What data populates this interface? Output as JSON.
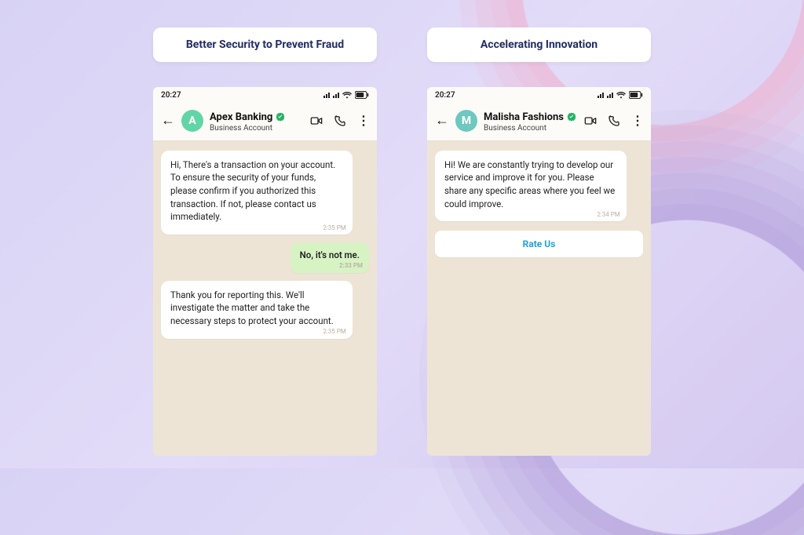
{
  "left": {
    "label": "Better Security to Prevent Fraud",
    "status_time": "20:27",
    "avatar_letter": "A",
    "avatar_color": "#62d5a6",
    "business_name": "Apex Banking",
    "business_sub": "Business Account",
    "messages": [
      {
        "kind": "incoming",
        "text": "Hi, There's a transaction on your account. To ensure the security of your funds, please confirm if you authorized this transaction. If not, please contact us immediately.",
        "time": "2:35 PM"
      },
      {
        "kind": "outgoing",
        "text": "No, it's not me.",
        "time": "2:33 PM"
      },
      {
        "kind": "incoming",
        "text": "Thank you for reporting this. We'll investigate the matter and take the necessary steps to protect your account.",
        "time": "2:35 PM"
      }
    ]
  },
  "right": {
    "label": "Accelerating Innovation",
    "status_time": "20:27",
    "avatar_letter": "M",
    "avatar_color": "#6ec8c0",
    "business_name": "Malisha Fashions",
    "business_sub": "Business Account",
    "messages": [
      {
        "kind": "incoming",
        "text": "Hi! We are constantly trying to develop our service and improve it for you. Please share any specific areas where you feel we could improve.",
        "time": "2:34 PM"
      }
    ],
    "action_label": "Rate Us"
  }
}
